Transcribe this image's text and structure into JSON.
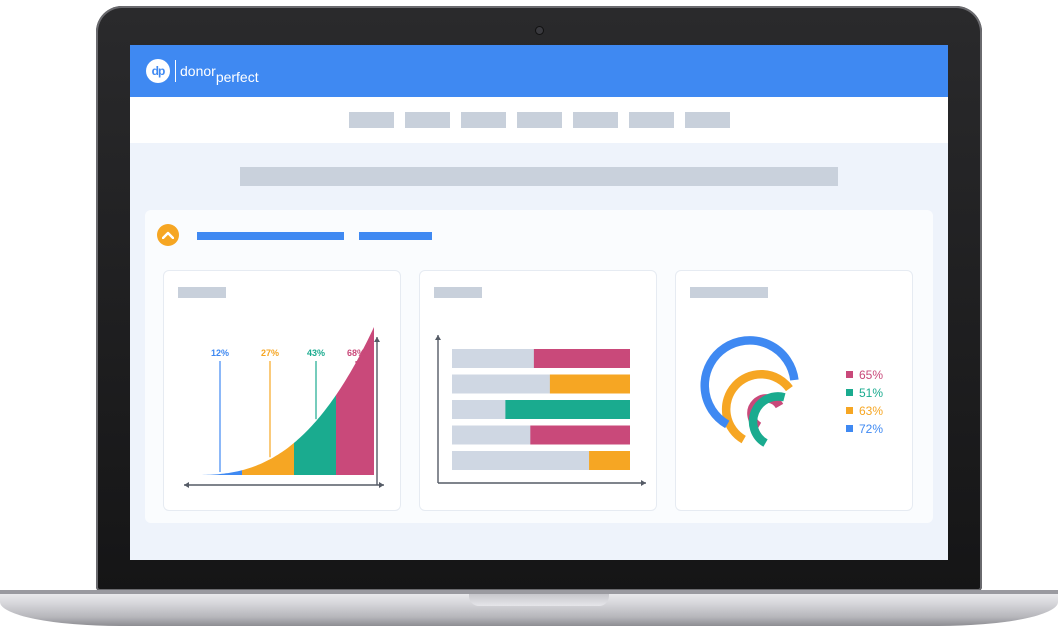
{
  "app": {
    "logo_badge": "dp",
    "logo_word1": "donor",
    "logo_word2": "perfect"
  },
  "colors": {
    "brand_blue": "#3f89f2",
    "accent_orange": "#f6a623",
    "pink": "#c9497a",
    "teal": "#1aab8f",
    "placeholder_gray": "#c8d0db"
  },
  "icons": {
    "collapse": "chevron-up-icon",
    "camera": "camera-dot"
  },
  "chart_data": [
    {
      "type": "area",
      "labels": [
        "12%",
        "27%",
        "43%",
        "68%"
      ],
      "values": [
        12,
        27,
        43,
        68
      ],
      "colors": [
        "#3f89f2",
        "#f6a623",
        "#1aab8f",
        "#c9497a"
      ]
    },
    {
      "type": "bar",
      "orientation": "horizontal",
      "rows": [
        {
          "color": "#c9497a",
          "colored_fraction": 0.54
        },
        {
          "color": "#f6a623",
          "colored_fraction": 0.45
        },
        {
          "color": "#1aab8f",
          "colored_fraction": 0.7
        },
        {
          "color": "#c9497a",
          "colored_fraction": 0.56
        },
        {
          "color": "#f6a623",
          "colored_fraction": 0.23
        }
      ]
    },
    {
      "type": "radial-bar",
      "labels": [
        "65%",
        "51%",
        "63%",
        "72%"
      ],
      "values": [
        65,
        51,
        63,
        72
      ],
      "colors": [
        "#c9497a",
        "#1aab8f",
        "#f6a623",
        "#3f89f2"
      ]
    }
  ]
}
